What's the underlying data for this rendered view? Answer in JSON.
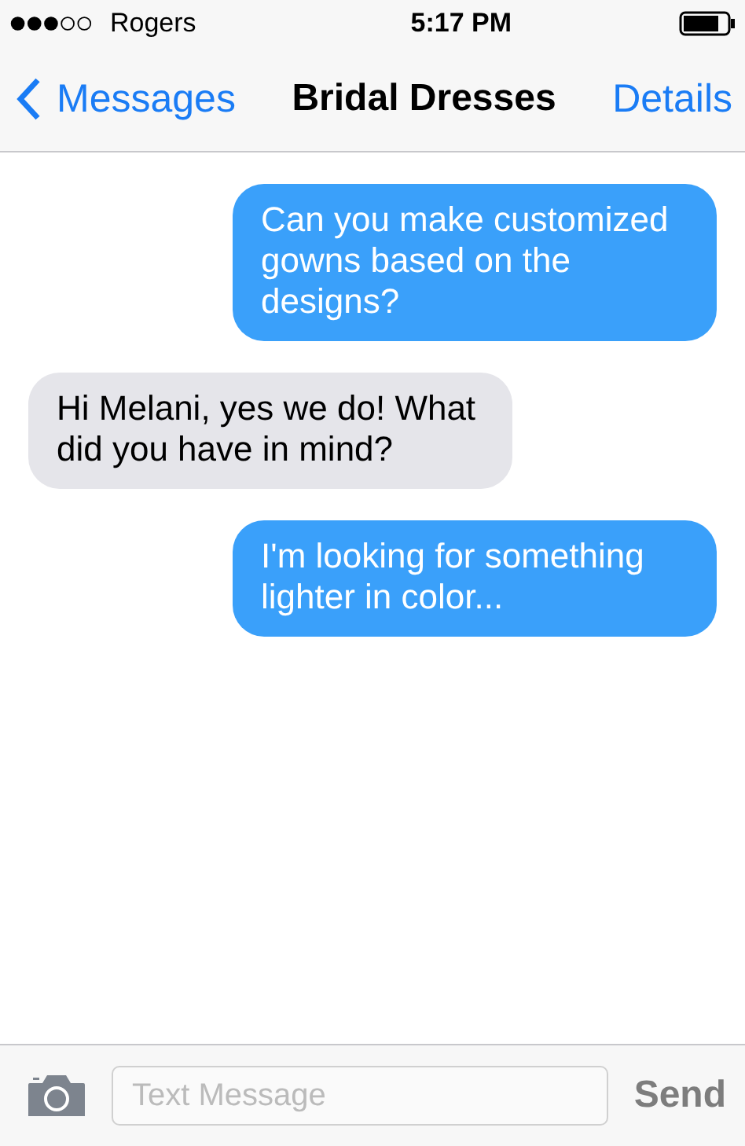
{
  "status_bar": {
    "carrier": "Rogers",
    "time": "5:17 PM"
  },
  "nav": {
    "back": "Messages",
    "title": "Bridal Dresses",
    "action": "Details"
  },
  "messages": [
    {
      "kind": "sent",
      "text": "Can you make customized gowns based on the designs?"
    },
    {
      "kind": "received",
      "text": "Hi Melani, yes we do! What did you have in mind?"
    },
    {
      "kind": "sent",
      "text": "I'm looking for something lighter in color..."
    }
  ],
  "composer": {
    "placeholder": "Text Message",
    "send": "Send"
  }
}
